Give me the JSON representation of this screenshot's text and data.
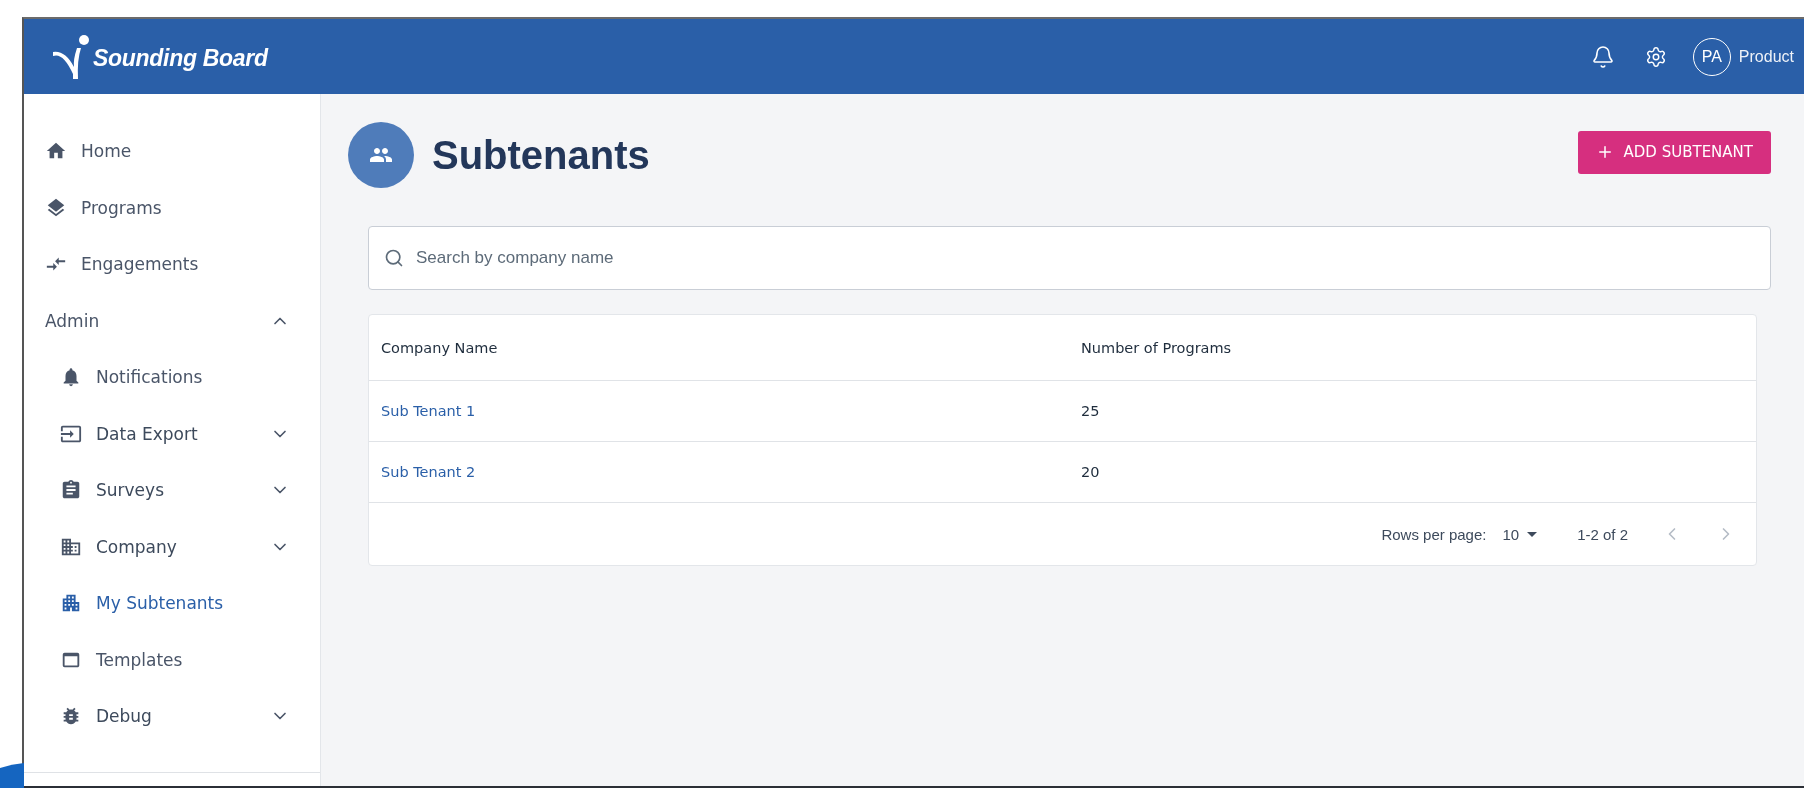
{
  "header": {
    "logo_text": "Sounding Board",
    "avatar_initials": "PA",
    "user_name": "Product"
  },
  "sidebar": {
    "items": [
      {
        "kind": "item",
        "label": "Home",
        "selected": false
      },
      {
        "kind": "item",
        "label": "Programs",
        "selected": false
      },
      {
        "kind": "item",
        "label": "Engagements",
        "selected": false
      },
      {
        "kind": "section",
        "label": "Admin",
        "selected": false,
        "expanded": true
      },
      {
        "kind": "subitem",
        "label": "Notifications",
        "selected": false
      },
      {
        "kind": "subitem",
        "label": "Data Export",
        "selected": false,
        "expanded": false
      },
      {
        "kind": "subitem",
        "label": "Surveys",
        "selected": false,
        "expanded": false
      },
      {
        "kind": "subitem",
        "label": "Company",
        "selected": false,
        "expanded": false
      },
      {
        "kind": "subitem",
        "label": "My Subtenants",
        "selected": true
      },
      {
        "kind": "subitem",
        "label": "Templates",
        "selected": false
      },
      {
        "kind": "subitem",
        "label": "Debug",
        "selected": false,
        "expanded": false
      }
    ]
  },
  "page": {
    "title": "Subtenants",
    "add_button": "ADD SUBTENANT"
  },
  "search": {
    "placeholder": "Search by company name"
  },
  "table": {
    "columns": [
      "Company Name",
      "Number of Programs"
    ],
    "rows": [
      {
        "company": "Sub Tenant 1",
        "programs": "25"
      },
      {
        "company": "Sub Tenant 2",
        "programs": "20"
      }
    ]
  },
  "pagination": {
    "rows_per_page_label": "Rows per page:",
    "rows_per_page": "10",
    "range": "1-2 of 2"
  }
}
